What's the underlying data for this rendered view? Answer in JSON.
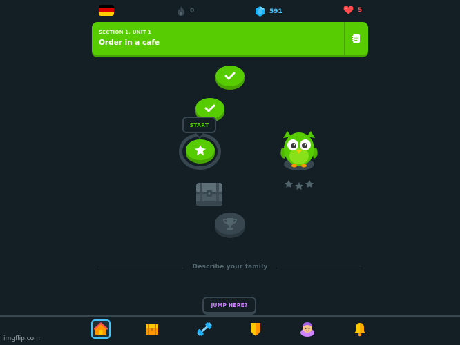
{
  "topbar": {
    "language_flag": "german-flag",
    "flag_colors": [
      "#000000",
      "#dd0000",
      "#ffce00"
    ],
    "streak": "0",
    "gems": "591",
    "hearts": "5"
  },
  "unit_banner": {
    "section": "SECTION 1, UNIT 1",
    "title": "Order in a cafe",
    "guide_icon": "notebook-icon",
    "color": "#58cc02"
  },
  "path": {
    "tooltip": "START",
    "nodes": [
      {
        "status": "completed",
        "icon": "check-icon"
      },
      {
        "status": "completed",
        "icon": "check-icon"
      },
      {
        "status": "current",
        "icon": "star-icon"
      },
      {
        "status": "locked",
        "icon": "chest-icon"
      },
      {
        "status": "locked",
        "icon": "trophy-icon"
      }
    ]
  },
  "next_section": {
    "label": "Describe your family",
    "jump_label": "JUMP HERE?"
  },
  "bottom_nav": [
    {
      "icon": "home-icon",
      "active": true
    },
    {
      "icon": "alphabet-chest-icon",
      "active": false
    },
    {
      "icon": "dumbbell-icon",
      "active": false
    },
    {
      "icon": "shield-icon",
      "active": false
    },
    {
      "icon": "profile-avatar-icon",
      "active": false
    },
    {
      "icon": "more-icon",
      "active": false
    }
  ],
  "watermark": "imgflip.com"
}
